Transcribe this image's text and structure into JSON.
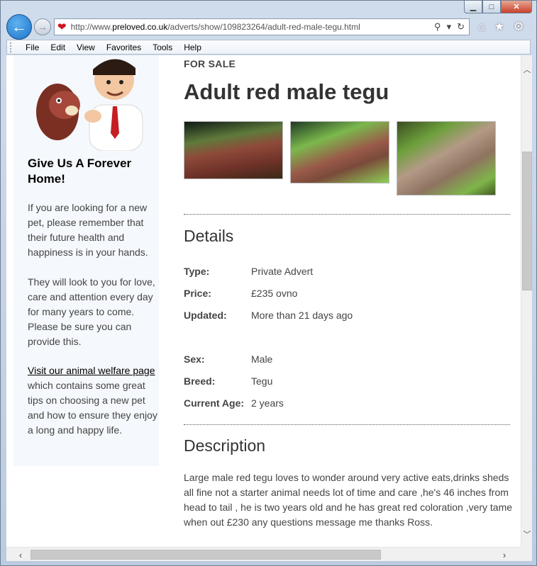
{
  "browser": {
    "url_prefix": "http://www.",
    "url_domain": "preloved.co.uk",
    "url_path": "/adverts/show/109823264/adult-red-male-tegu.html",
    "menu": [
      "File",
      "Edit",
      "View",
      "Favorites",
      "Tools",
      "Help"
    ]
  },
  "sidebar": {
    "heading": "Give Us A Forever Home!",
    "para1": "If you are looking for a new pet, please remember that their future health and happiness is in your hands.",
    "para2": "They will look to you for love, care and attention every day for many years to come. Please be sure you can provide this.",
    "link": "Visit our animal welfare page",
    "para3": "which contains some great tips on choosing a new pet and how to ensure they enjoy a long and happy life."
  },
  "advert": {
    "tag": "FOR SALE",
    "title": "Adult red male tegu",
    "details_heading": "Details",
    "details": [
      {
        "label": "Type:",
        "value": "Private Advert"
      },
      {
        "label": "Price:",
        "value": "£235 ovno"
      },
      {
        "label": "Updated:",
        "value": "More than 21 days ago"
      },
      {
        "label": "Sex:",
        "value": "Male"
      },
      {
        "label": "Breed:",
        "value": "Tegu"
      },
      {
        "label": "Current Age:",
        "value": "2 years"
      }
    ],
    "description_heading": "Description",
    "description": "Large male red tegu loves to wonder around very active eats,drinks sheds all fine not a starter animal needs lot of time and care ,he's 46 inches from head to tail , he is two years old and he has great red coloration ,very tame when out £230 any questions message me thanks Ross."
  },
  "colors": {
    "accent": "#1a73c9",
    "sidebar_bg": "#f5f8fc",
    "text": "#444444"
  }
}
